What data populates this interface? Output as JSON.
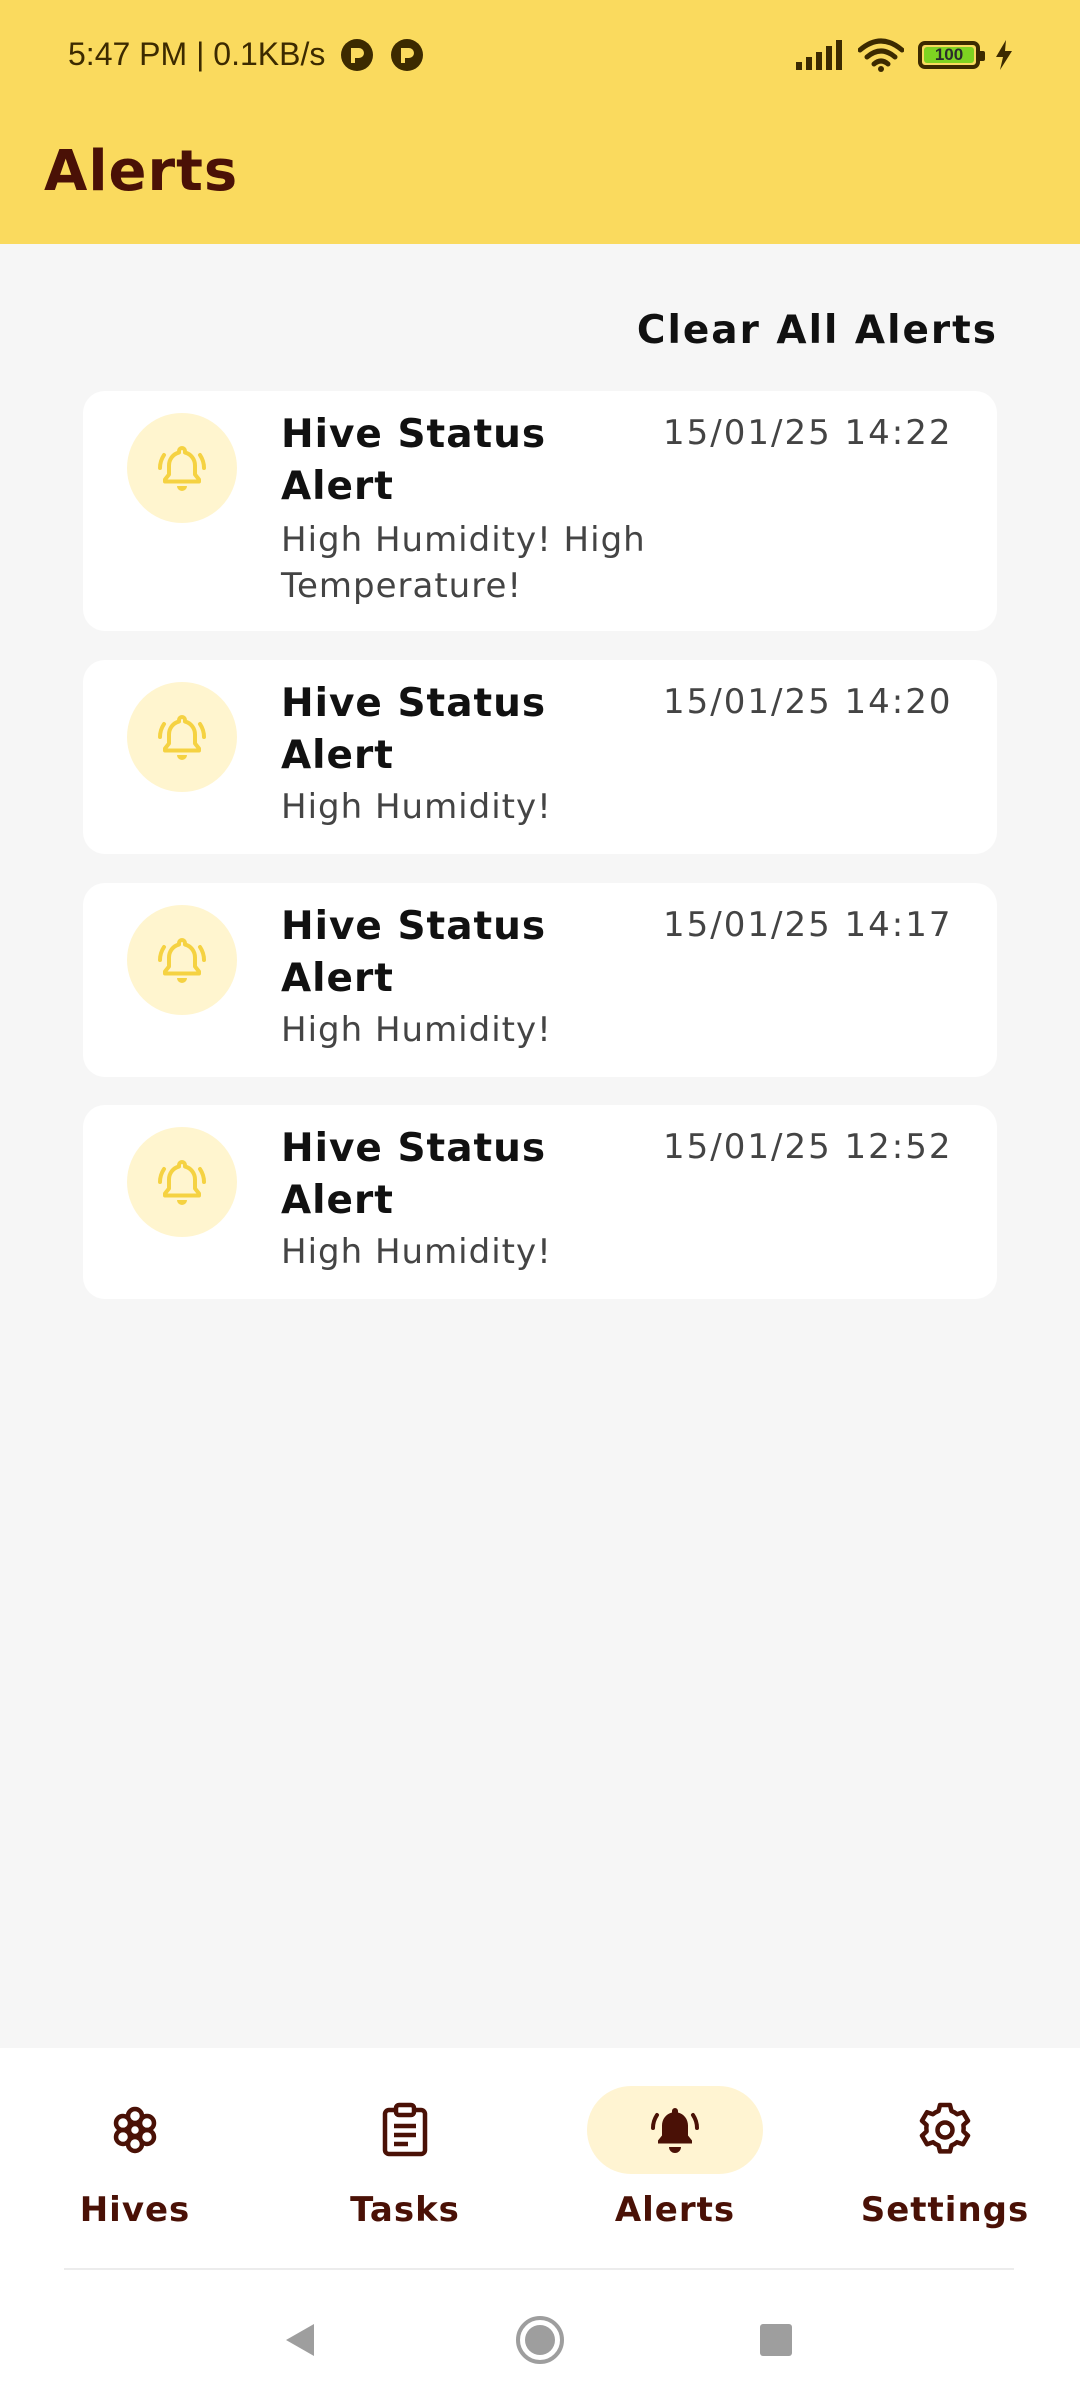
{
  "status_bar": {
    "time_speed": "5:47 PM | 0.1KB/s",
    "battery_level": "100",
    "battery_color": "#7ed321"
  },
  "header": {
    "title": "Alerts",
    "background": "#fada5e"
  },
  "actions": {
    "clear_all_label": "Clear All Alerts"
  },
  "alerts": [
    {
      "title": "Hive Status Alert",
      "time": "15/01/25 14:22",
      "message": "High Humidity! High Temperature!",
      "icon": "bell-icon"
    },
    {
      "title": "Hive Status Alert",
      "time": "15/01/25 14:20",
      "message": "High Humidity!",
      "icon": "bell-icon"
    },
    {
      "title": "Hive Status Alert",
      "time": "15/01/25 14:17",
      "message": "High Humidity!",
      "icon": "bell-icon"
    },
    {
      "title": "Hive Status Alert",
      "time": "15/01/25 12:52",
      "message": "High Humidity!",
      "icon": "bell-icon"
    }
  ],
  "bottom_nav": {
    "items": [
      {
        "label": "Hives",
        "icon": "hive-flower-icon",
        "active": false
      },
      {
        "label": "Tasks",
        "icon": "clipboard-icon",
        "active": false
      },
      {
        "label": "Alerts",
        "icon": "bell-icon",
        "active": true
      },
      {
        "label": "Settings",
        "icon": "gear-icon",
        "active": false
      }
    ]
  },
  "colors": {
    "accent": "#fada5e",
    "brand_dark": "#4a1106",
    "alert_icon": "#f5d242",
    "alert_icon_bg": "#fff5cf",
    "active_nav_bg": "#fff4d2"
  }
}
